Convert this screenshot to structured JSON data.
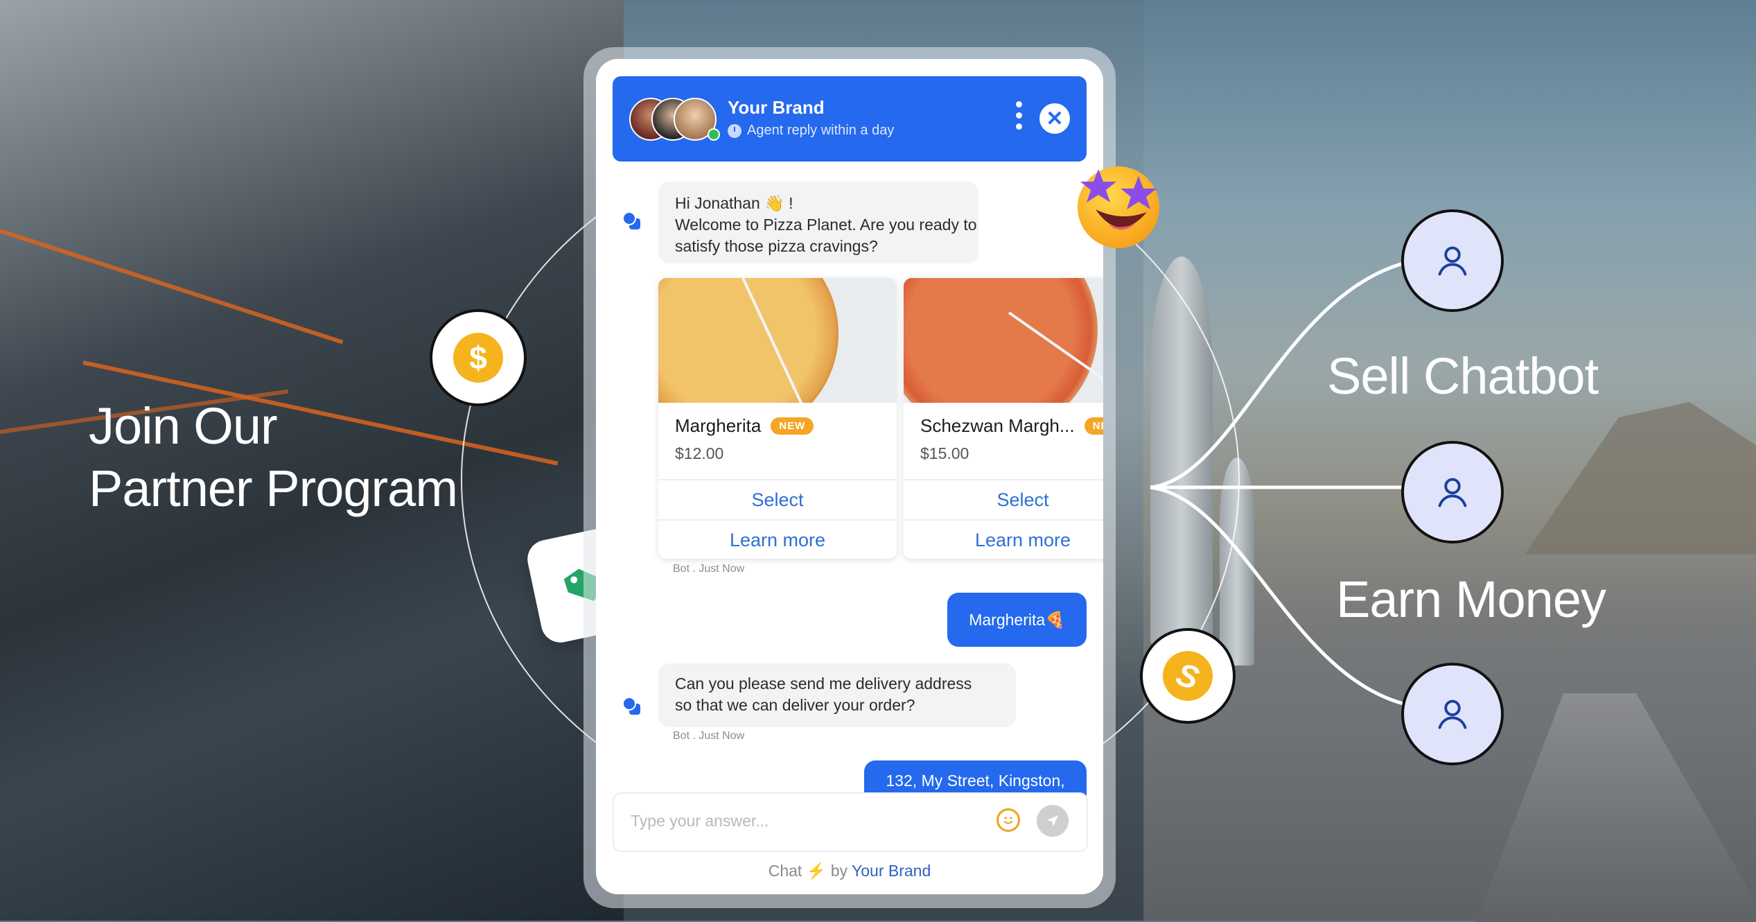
{
  "hero": {
    "headline_line1": "Join Our",
    "headline_line2": "Partner Program",
    "label_top": "Sell Chatbot",
    "label_bottom": "Earn Money"
  },
  "decor": {
    "coin_symbol": "$",
    "coin_alt_symbol": "S",
    "icons": [
      "dollar-coin-icon",
      "price-tag-icon",
      "star-struck-emoji-icon",
      "user-icon",
      "user-icon",
      "user-icon"
    ]
  },
  "colors": {
    "brand_blue": "#2469ee",
    "badge_orange": "#f5a623",
    "coin_yellow": "#f5b41d",
    "tag_green": "#22a565",
    "user_node_bg": "#dfe4fb"
  },
  "chat": {
    "header": {
      "brand": "Your Brand",
      "status": "Agent reply within a day",
      "close_glyph": "✕"
    },
    "messages": [
      {
        "from": "bot",
        "lines": [
          "Hi Jonathan 👋 !",
          "Welcome to Pizza Planet. Are you ready to",
          "satisfy those pizza cravings?"
        ]
      },
      {
        "from": "bot",
        "meta": "Bot . Just Now"
      },
      {
        "from": "user",
        "text": "Margherita🍕"
      },
      {
        "from": "bot",
        "lines": [
          "Can you please send me delivery address",
          "so that we can deliver your order?"
        ],
        "meta": "Bot . Just Now"
      },
      {
        "from": "user",
        "text": "132, My Street, Kingston,"
      }
    ],
    "products": [
      {
        "name": "Margherita",
        "badge": "NEW",
        "price": "$12.00",
        "select": "Select",
        "learn": "Learn more"
      },
      {
        "name": "Schezwan Margh...",
        "badge": "NEW",
        "price": "$15.00",
        "select": "Select",
        "learn": "Learn more"
      }
    ],
    "composer": {
      "placeholder": "Type your answer..."
    },
    "footer": {
      "prefix": "Chat",
      "bolt": "⚡",
      "by": "by",
      "brand": "Your Brand"
    }
  }
}
